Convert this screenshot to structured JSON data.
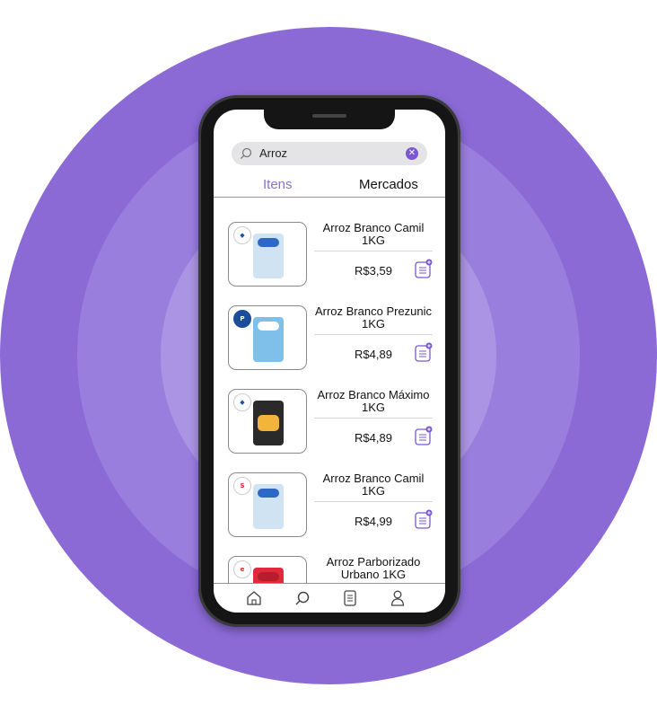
{
  "search": {
    "value": "Arroz",
    "placeholder": ""
  },
  "tabs": [
    {
      "label": "Itens",
      "active": true
    },
    {
      "label": "Mercados",
      "active": false
    }
  ],
  "colors": {
    "accent": "#8c6fd8",
    "background_ring": "#8b6ad6"
  },
  "items": [
    {
      "name": "Arroz Branco Camil 1KG",
      "price": "R$3,59",
      "store": "Carrefour",
      "store_icon": "carrefour-logo"
    },
    {
      "name": "Arroz Branco Prezunic 1KG",
      "price": "R$4,89",
      "store": "Prezunic",
      "store_icon": "prezunic-logo"
    },
    {
      "name": "Arroz Branco Máximo 1KG",
      "price": "R$4,89",
      "store": "Carrefour",
      "store_icon": "carrefour-logo"
    },
    {
      "name": "Arroz Branco Camil 1KG",
      "price": "R$4,99",
      "store": "Super Mais",
      "store_icon": "super-mais-logo"
    },
    {
      "name": "Arroz Parborizado Urbano 1KG",
      "price": "",
      "store": "Extra",
      "store_icon": "extra-logo"
    }
  ],
  "bottom_nav": [
    {
      "icon": "home-icon"
    },
    {
      "icon": "search-icon"
    },
    {
      "icon": "shopping-list-icon"
    },
    {
      "icon": "profile-icon"
    }
  ]
}
